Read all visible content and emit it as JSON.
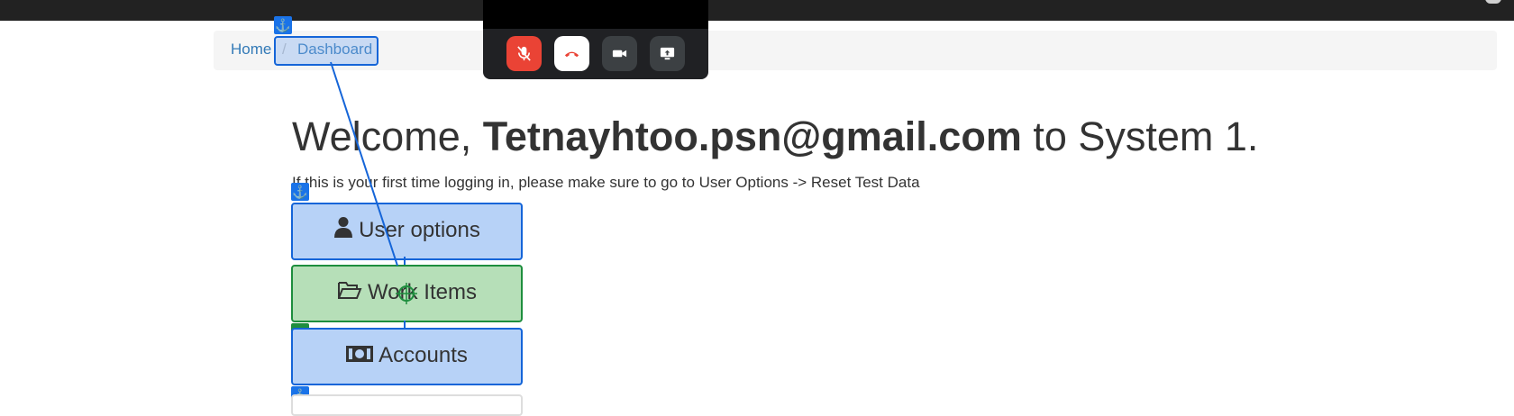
{
  "breadcrumb": {
    "home_label": "Home",
    "separator": "/",
    "current_label": "Dashboard"
  },
  "welcome": {
    "prefix": "Welcome, ",
    "user_email": "Tetnayhtoo.psn@gmail.com",
    "suffix": " to System 1."
  },
  "intro_text": "If this is your first time logging in, please make sure to go to User Options -> Reset Test Data",
  "menu": {
    "user_options_label": "User options",
    "work_items_label": "Work Items",
    "accounts_label": "Accounts"
  },
  "call_controls": {
    "mute_icon": "mic-off-icon",
    "hangup_icon": "phone-hangup-icon",
    "camera_icon": "video-camera-icon",
    "share_icon": "screen-share-icon",
    "colors": {
      "mute": "#ea4335",
      "hangup": "#ffffff",
      "other": "#3c4043"
    }
  },
  "overlay": {
    "anchor_glyph": "⚓",
    "target_glyph": "◎",
    "colors": {
      "anchor": "#1a73e8",
      "target": "#1e8e3e"
    }
  }
}
